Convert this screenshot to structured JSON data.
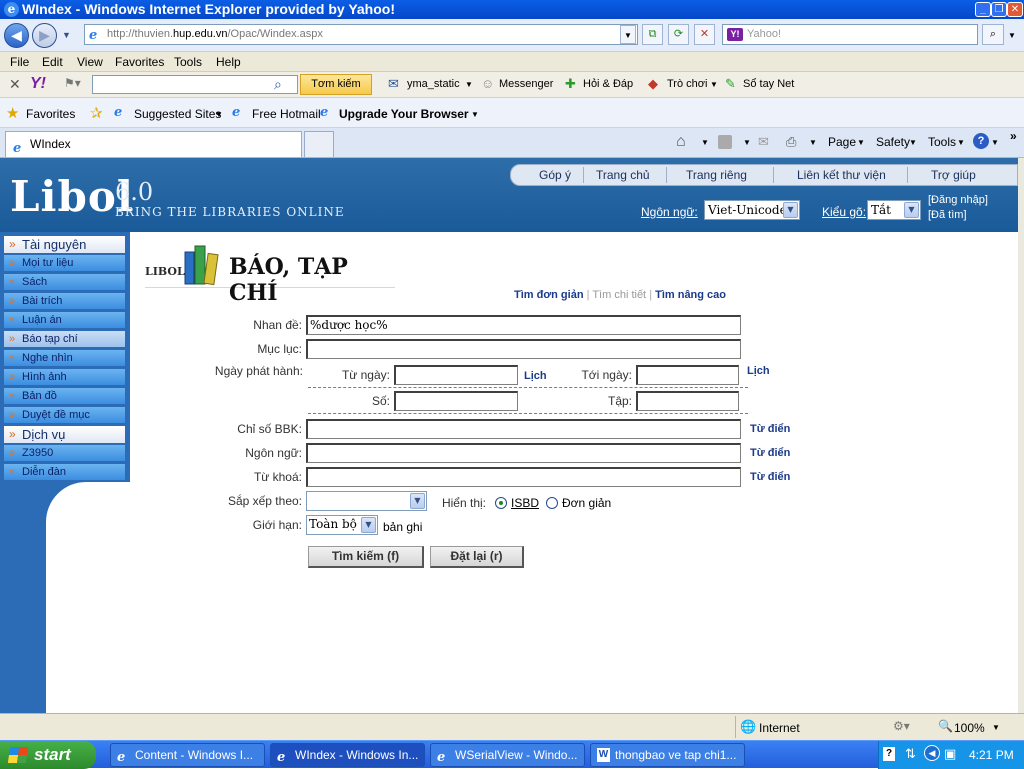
{
  "window": {
    "title": "WIndex - Windows Internet Explorer provided by Yahoo!"
  },
  "browser": {
    "address": "http://thuvien.hup.edu.vn/Opac/Windex.aspx",
    "address_pre": "http://thuvien.",
    "address_domain": "hup.edu.vn",
    "address_post": "/Opac/Windex.aspx",
    "search_placeholder": "Yahoo!",
    "menu": [
      "File",
      "Edit",
      "View",
      "Favorites",
      "Tools",
      "Help"
    ],
    "yahoo_toolbar": {
      "web_search": "Tơm kiếm web",
      "mail": "yma_static",
      "messenger": "Messenger",
      "answers": "Hỏi & Đáp",
      "games": "Trò chơi",
      "notepad": "Sổ tay Net"
    },
    "favorites": {
      "label": "Favorites",
      "suggested": "Suggested Sites",
      "hotmail": "Free Hotmail",
      "upgrade": "Upgrade Your Browser"
    },
    "tab": "WIndex",
    "commands": {
      "page": "Page",
      "safety": "Safety",
      "tools": "Tools"
    }
  },
  "libol": {
    "logo": "Libol",
    "version": "6.0",
    "tagline": "BRING THE LIBRARIES ONLINE",
    "nav": [
      "Góp ý",
      "Trang chủ",
      "Trang riêng",
      "Liên kết thư viện",
      "Trợ giúp"
    ],
    "language_label": "Ngôn ngữ:",
    "language_value": "Viet-Unicode",
    "input_label": "Kiểu gõ:",
    "input_value": "Tắt",
    "login": "[Đăng nhập]",
    "found": "[Đã tìm]"
  },
  "sidebar": {
    "resources_title": "Tài nguyên",
    "resources": [
      "Mọi tư liệu",
      "Sách",
      "Bài trích",
      "Luận án",
      "Báo tạp chí",
      "Nghe nhìn",
      "Hình ảnh",
      "Bản đồ",
      "Duyệt đề mục"
    ],
    "services_title": "Dịch vụ",
    "services": [
      "Z3950",
      "Diễn đàn"
    ]
  },
  "form": {
    "heading_logo": "LIBOL",
    "title": "BÁO, TẠP CHÍ",
    "modes": {
      "simple": "Tìm đơn giản",
      "detail": "Tìm chi tiết",
      "advanced": "Tìm nâng cao"
    },
    "title_label": "Nhan đề:",
    "title_value": "%dược học%",
    "contents_label": "Mục lục:",
    "pubdate_label": "Ngày phát hành:",
    "from_label": "Từ ngày:",
    "to_label": "Tới ngày:",
    "calendar": "Lịch",
    "number_label": "Số:",
    "volume_label": "Tập:",
    "bbk_label": "Chỉ số BBK:",
    "language_label": "Ngôn ngữ:",
    "keyword_label": "Từ khoá:",
    "dictionary": "Từ điển",
    "sort_label": "Sắp xếp theo:",
    "display_label": "Hiển thị:",
    "display_isbd": "ISBD",
    "display_simple": "Đơn giản",
    "limit_label": "Giới hạn:",
    "limit_value": "Toàn bộ",
    "limit_unit": "bản ghi",
    "search_button": "Tìm kiếm (f)",
    "reset_button": "Đặt lại (r)"
  },
  "status": {
    "zone": "Internet",
    "zoom": "100%"
  },
  "taskbar": {
    "start": "start",
    "items": [
      "Content - Windows I...",
      "WIndex - Windows In...",
      "WSerialView - Windo...",
      "thongbao ve tap chi1..."
    ],
    "clock": "4:21 PM"
  },
  "colors": {
    "libol_blue": "#2c6bb5",
    "sidebar_item": "#3b8de0",
    "xp_title": "#0a5ee6",
    "taskbar": "#245edb"
  }
}
